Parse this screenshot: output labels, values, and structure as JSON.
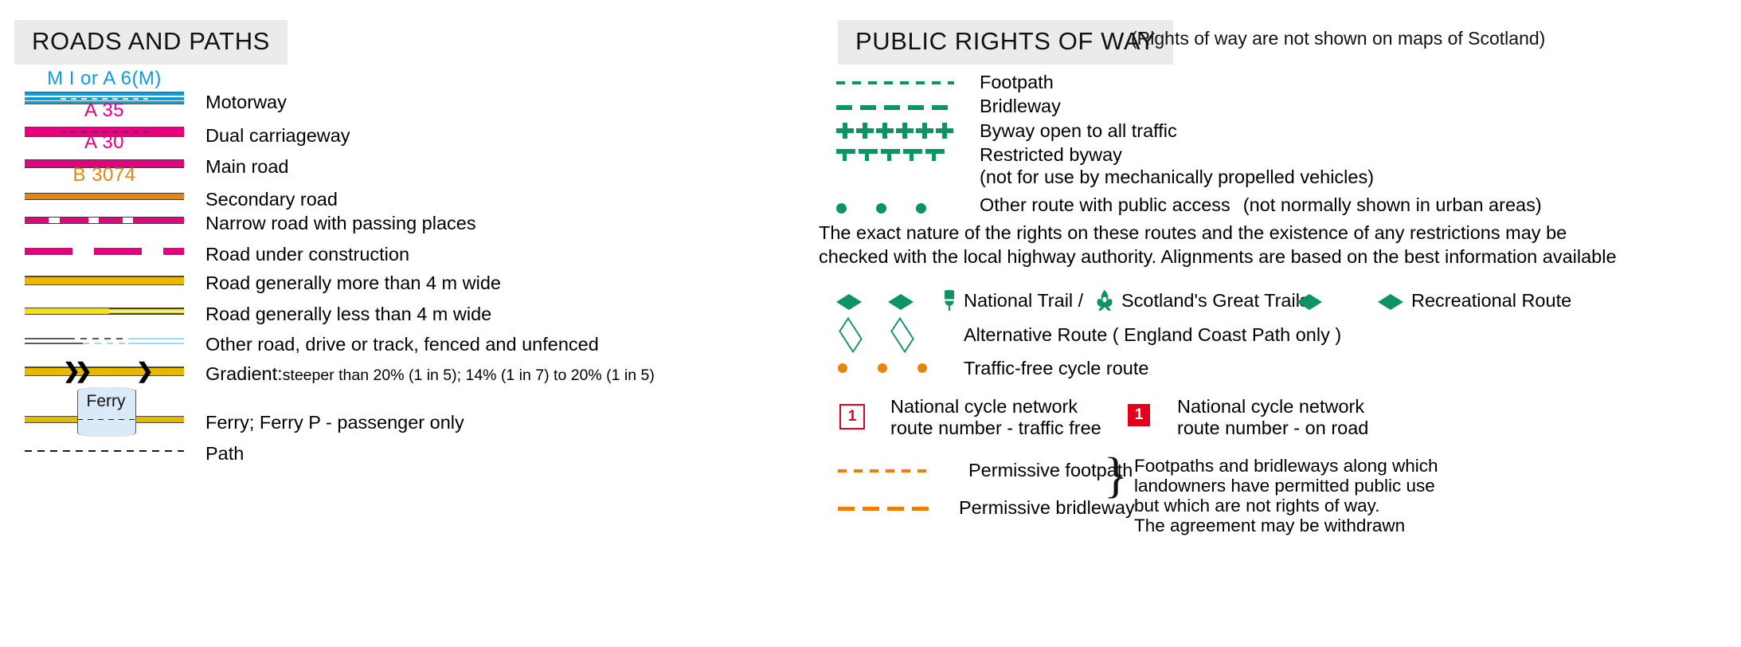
{
  "roads": {
    "header": "ROADS AND PATHS",
    "items": [
      {
        "symbol": "motorway",
        "shield": "M I or A 6(M)",
        "label": "Motorway"
      },
      {
        "symbol": "dual-carriageway",
        "shield": "A 35",
        "label": "Dual carriageway"
      },
      {
        "symbol": "main-road",
        "shield": "A 30",
        "label": "Main road"
      },
      {
        "symbol": "secondary-road",
        "shield": "B 3074",
        "label": "Secondary road"
      },
      {
        "symbol": "narrow-road",
        "shield": "",
        "label": "Narrow road with passing places"
      },
      {
        "symbol": "road-under-construction",
        "shield": "",
        "label": "Road under construction"
      },
      {
        "symbol": "road-more-than-4m",
        "shield": "",
        "label": "Road generally more than 4 m wide"
      },
      {
        "symbol": "road-less-than-4m",
        "shield": "",
        "label": "Road generally less than 4 m wide"
      },
      {
        "symbol": "other-road-track",
        "shield": "",
        "label": "Other road, drive or track, fenced and unfenced"
      },
      {
        "symbol": "gradient",
        "shield": "",
        "label_lead": "Gradient:",
        "label_small": "steeper than 20% (1 in 5);   14% (1 in 7) to 20% (1 in 5)"
      },
      {
        "symbol": "ferry",
        "shield": "",
        "label": "Ferry;  Ferry P - passenger only",
        "badge": "Ferry"
      },
      {
        "symbol": "path",
        "shield": "",
        "label": "Path"
      }
    ]
  },
  "rights_of_way": {
    "header": "PUBLIC RIGHTS OF WAY",
    "header_note": "(Rights of way are not shown on maps of Scotland)",
    "items": [
      {
        "symbol": "footpath-dashed-green",
        "label": "Footpath"
      },
      {
        "symbol": "bridleway-dashed-green",
        "label": "Bridleway"
      },
      {
        "symbol": "byway-plus-green",
        "label": "Byway open to all traffic"
      },
      {
        "symbol": "restricted-byway-green",
        "label": "Restricted byway",
        "label2": "(not for use by mechanically propelled vehicles)"
      },
      {
        "symbol": "other-route-dots-green",
        "label": "Other route with public access",
        "note": "(not normally shown in urban areas)"
      }
    ],
    "paragraph_line1": "The exact nature of the rights on these routes and the existence of any restrictions may be",
    "paragraph_line2": "checked with the local highway authority. Alignments are based on the best information available",
    "national_trail": {
      "label_a": "National Trail /",
      "label_b": "Scotland's Great Trails",
      "recreational": "Recreational Route"
    },
    "alternative_route": "Alternative Route  ( England Coast Path only )",
    "traffic_free_cycle": "Traffic-free cycle route",
    "cycle_network": [
      {
        "badge": "1",
        "style": "traffic-free",
        "line1": "National cycle network",
        "line2": "route number - traffic free"
      },
      {
        "badge": "1",
        "style": "on-road",
        "line1": "National cycle network",
        "line2": "route number - on road"
      }
    ],
    "permissive": [
      {
        "symbol": "permissive-footpath-orange",
        "label": "Permissive footpath"
      },
      {
        "symbol": "permissive-bridleway-orange",
        "label": "Permissive bridleway"
      }
    ],
    "permissive_note": [
      "Footpaths and bridleways along which",
      "landowners have permitted public use",
      "but which are not rights of way.",
      "The agreement may be withdrawn"
    ]
  },
  "colors": {
    "motorway_blue": "#0d9ddb",
    "road_pink": "#e6007e",
    "secondary_orange": "#e8850c",
    "road_yellow": "#e8b700",
    "minor_yellow": "#f5e400",
    "row_green": "#0e9464",
    "cycle_red": "#e2001a",
    "permissive_orange": "#f07d00",
    "header_bg": "#ebebeb"
  }
}
